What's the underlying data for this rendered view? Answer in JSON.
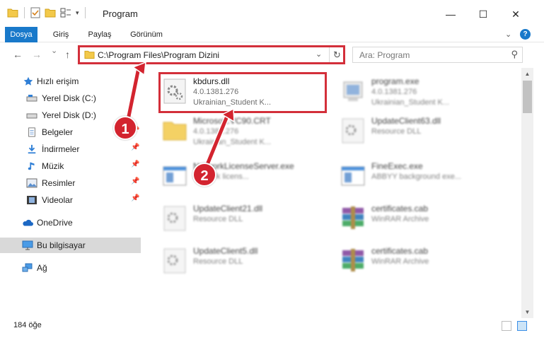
{
  "window": {
    "title": "Program",
    "controls": {
      "minimize": "—",
      "maximize": "☐",
      "close": "✕"
    }
  },
  "ribbon": {
    "tabs": [
      {
        "label": "Dosya",
        "active": true
      },
      {
        "label": "Giriş",
        "active": false
      },
      {
        "label": "Paylaş",
        "active": false
      },
      {
        "label": "Görünüm",
        "active": false
      }
    ],
    "help": "?"
  },
  "navigation": {
    "back": "←",
    "forward": "→",
    "recent": "⌄",
    "up": "↑",
    "address": "C:\\Program Files\\Program Dizini",
    "search_placeholder": "Ara: Program"
  },
  "sidebar": {
    "items": [
      {
        "label": "Hızlı erişim",
        "icon": "star-icon",
        "pinned": false
      },
      {
        "label": "Yerel Disk (C:)",
        "icon": "drive-icon",
        "pinned": true
      },
      {
        "label": "Yerel Disk (D:)",
        "icon": "drive-icon",
        "pinned": true
      },
      {
        "label": "Belgeler",
        "icon": "documents-icon",
        "pinned": true
      },
      {
        "label": "İndirmeler",
        "icon": "download-icon",
        "pinned": true
      },
      {
        "label": "Müzik",
        "icon": "music-icon",
        "pinned": true
      },
      {
        "label": "Resimler",
        "icon": "pictures-icon",
        "pinned": true
      },
      {
        "label": "Videolar",
        "icon": "videos-icon",
        "pinned": true
      },
      {
        "label": "OneDrive",
        "icon": "cloud-icon",
        "pinned": false
      },
      {
        "label": "Bu bilgisayar",
        "icon": "computer-icon",
        "pinned": false,
        "selected": true
      },
      {
        "label": "Ağ",
        "icon": "network-icon",
        "pinned": false
      }
    ]
  },
  "files": [
    {
      "name": "kbdurs.dll",
      "line1": "4.0.1381.276",
      "line2": "Ukrainian_Student K...",
      "icon": "dll-gear-icon",
      "highlighted": true
    },
    {
      "name": "program.exe",
      "line1": "4.0.1381.276",
      "line2": "Ukrainian_Student K...",
      "icon": "exe-icon"
    },
    {
      "name": "Microsoft.VC90.CRT",
      "line1": "4.0.1381.276",
      "line2": "Ukrainian_Student K...",
      "icon": "folder-icon"
    },
    {
      "name": "UpdateClient63.dll",
      "line1": "Resource DLL",
      "line2": "",
      "icon": "dll-gear-icon"
    },
    {
      "name": "NetworkLicenseServer.exe",
      "line1": "network licens...",
      "line2": "",
      "icon": "exe-window-icon"
    },
    {
      "name": "FineExec.exe",
      "line1": "ABBYY background exe...",
      "line2": "",
      "icon": "exe-window-icon"
    },
    {
      "name": "UpdateClient21.dll",
      "line1": "Resource DLL",
      "line2": "",
      "icon": "dll-gear-icon"
    },
    {
      "name": "certificates.cab",
      "line1": "WinRAR Archive",
      "line2": "",
      "icon": "winrar-icon"
    },
    {
      "name": "UpdateClient5.dll",
      "line1": "Resource DLL",
      "line2": "",
      "icon": "dll-gear-icon"
    },
    {
      "name": "certificates.cab",
      "line1": "WinRAR Archive",
      "line2": "",
      "icon": "winrar-icon"
    }
  ],
  "status": {
    "item_count": "184 öğe"
  },
  "annotations": {
    "step1": "1",
    "step2": "2"
  },
  "colors": {
    "accent": "#1979ca",
    "highlight": "#d32f3a",
    "badge": "#d3242f"
  }
}
